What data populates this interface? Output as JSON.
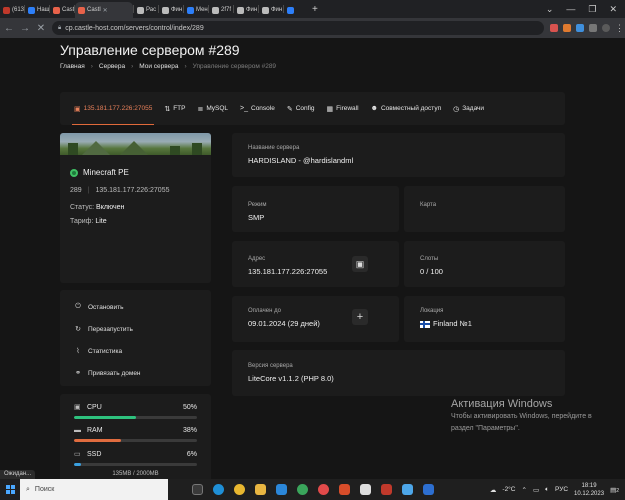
{
  "browser": {
    "tabs": [
      {
        "label": "(613",
        "color": "#c0392b"
      },
      {
        "label": "Наш",
        "color": "#2d7ff9"
      },
      {
        "label": "Castl",
        "color": "#e8624a"
      },
      {
        "label": "Castl",
        "color": "#e8624a",
        "active": true
      },
      {
        "label": "Рас",
        "color": "#bbbbbb"
      },
      {
        "label": "Фин",
        "color": "#bbbbbb"
      },
      {
        "label": "Мен",
        "color": "#2d7ff9"
      },
      {
        "label": "2f7f",
        "color": "#bbbbbb"
      },
      {
        "label": "Фин",
        "color": "#bbbbbb"
      },
      {
        "label": "Фин",
        "color": "#bbbbbb"
      },
      {
        "label": "",
        "color": "#2d7ff9"
      }
    ],
    "new_tab": "+",
    "url": "cp.castle-host.com/servers/control/index/289",
    "status_text": "Ожидан..."
  },
  "page": {
    "title": "Управление сервером #289",
    "breadcrumb": [
      "Главная",
      "Сервера",
      "Мои сервера",
      "Управление сервером #289"
    ]
  },
  "server_tabs": [
    {
      "label": "135.181.177.226:27055",
      "icon": "server-icon",
      "glyph": "▣"
    },
    {
      "label": "FTP",
      "icon": "ftp-icon",
      "glyph": "⇅"
    },
    {
      "label": "MySQL",
      "icon": "database-icon",
      "glyph": "≣"
    },
    {
      "label": "Console",
      "icon": "console-icon",
      "glyph": ">_"
    },
    {
      "label": "Config",
      "icon": "wrench-icon",
      "glyph": "✎"
    },
    {
      "label": "Firewall",
      "icon": "firewall-icon",
      "glyph": "▦"
    },
    {
      "label": "Совместный доступ",
      "icon": "users-icon",
      "glyph": "☻"
    },
    {
      "label": "Задачи",
      "icon": "clock-icon",
      "glyph": "◷"
    }
  ],
  "server": {
    "game": "Minecraft PE",
    "id": "289",
    "address": "135.181.177.226:27055",
    "status_label": "Статус:",
    "status_value": "Включен",
    "tariff_label": "Тариф:",
    "tariff_value": "Lite"
  },
  "actions": [
    {
      "label": "Остановить",
      "icon": "power-icon",
      "glyph": "⏻"
    },
    {
      "label": "Перезапустить",
      "icon": "restart-icon",
      "glyph": "↻"
    },
    {
      "label": "Статистика",
      "icon": "chart-icon",
      "glyph": "⌇"
    },
    {
      "label": "Привязать домен",
      "icon": "link-icon",
      "glyph": "⚭"
    }
  ],
  "resources": {
    "cpu": {
      "label": "CPU",
      "pct_text": "50%",
      "fraction": 0.5,
      "color": "#2ec27e"
    },
    "ram": {
      "label": "RAM",
      "pct_text": "38%",
      "fraction": 0.38,
      "color": "#e06c3f"
    },
    "ssd": {
      "label": "SSD",
      "pct_text": "6%",
      "fraction": 0.06,
      "color": "#3aa0e0",
      "detail": "135MB / 2000MB"
    }
  },
  "info": {
    "name_label": "Название сервера",
    "name_value": "HARDISLAND - @hardislandml",
    "mode_label": "Режим",
    "mode_value": "SMP",
    "map_label": "Карта",
    "addr_label": "Адрес",
    "addr_value": "135.181.177.226:27055",
    "slots_label": "Слоты",
    "slots_value": "0 / 100",
    "paid_label": "Оплачен до",
    "paid_value": "09.01.2024 (29 дней)",
    "location_label": "Локация",
    "location_value": "Finland №1",
    "version_label": "Версия сервера",
    "version_value": "LiteCore v1.1.2 (PHP 8.0)"
  },
  "watermark": {
    "title": "Активация Windows",
    "line1": "Чтобы активировать Windows, перейдите в",
    "line2": "раздел \"Параметры\"."
  },
  "taskbar": {
    "search_placeholder": "Поиск",
    "temperature": "-2°C",
    "language": "РУС",
    "time": "18:19",
    "date": "10.12.2023",
    "notifications": "2"
  }
}
